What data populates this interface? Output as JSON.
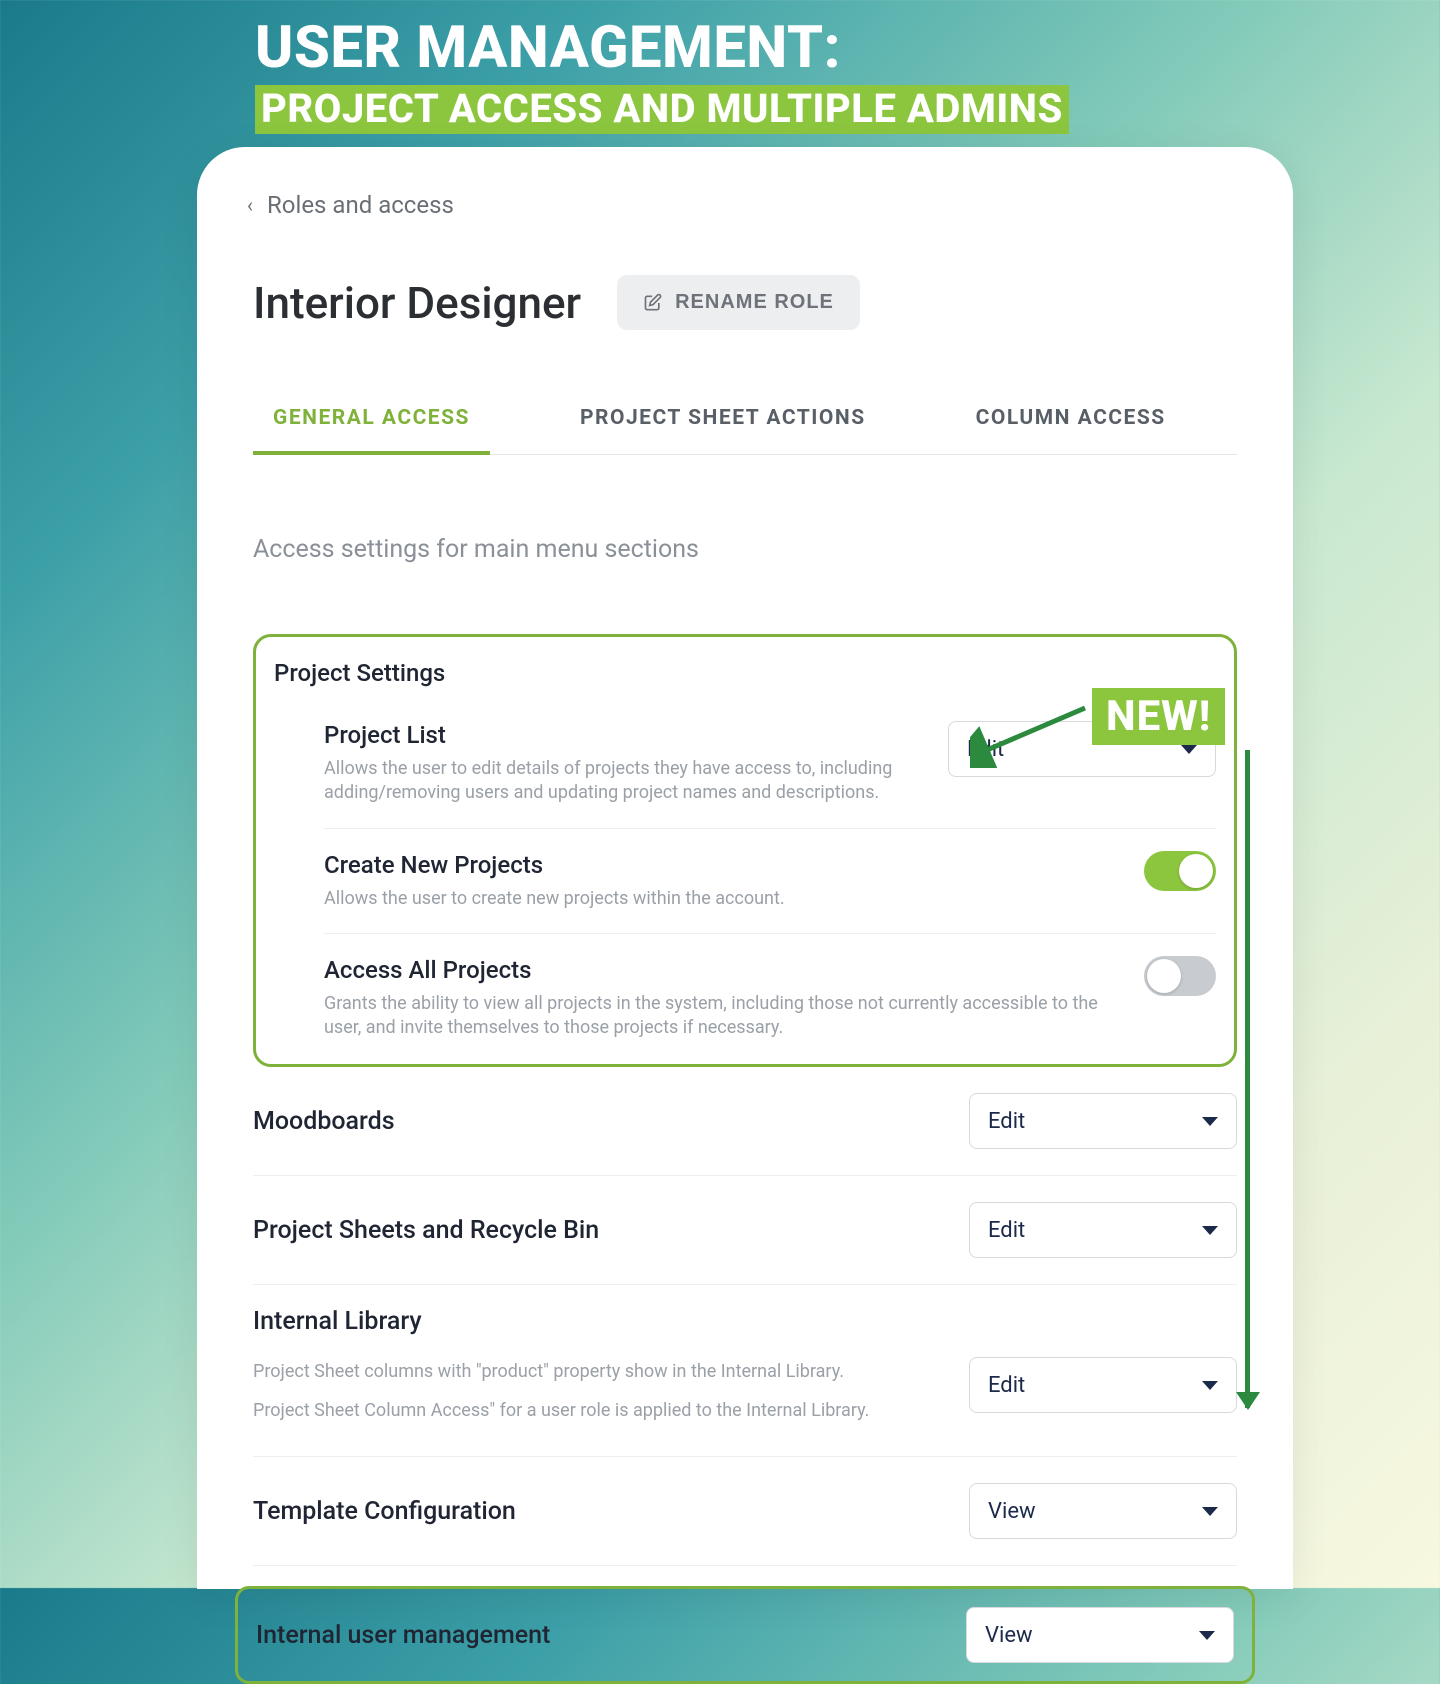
{
  "hero": {
    "title": "USER MANAGEMENT:",
    "subtitle": "PROJECT ACCESS AND MULTIPLE ADMINS"
  },
  "breadcrumb": {
    "label": "Roles and access"
  },
  "role": {
    "name": "Interior Designer",
    "rename_label": "RENAME ROLE"
  },
  "tabs": {
    "general": "GENERAL ACCESS",
    "project_sheet": "PROJECT SHEET ACTIONS",
    "column": "COLUMN ACCESS"
  },
  "section_description": "Access settings for main menu sections",
  "new_badge": "NEW!",
  "project_settings": {
    "title": "Project Settings",
    "project_list": {
      "title": "Project List",
      "desc": "Allows the user to edit details of projects they have access to, including adding/removing users and updating project names and descriptions.",
      "value": "Edit"
    },
    "create_new": {
      "title": "Create New Projects",
      "desc": "Allows the user to create new projects within the account.",
      "on": true
    },
    "access_all": {
      "title": "Access All Projects",
      "desc": "Grants the ability to view all projects in the system, including those not currently accessible to the user, and invite themselves to those projects if necessary.",
      "on": false
    }
  },
  "moodboards": {
    "title": "Moodboards",
    "value": "Edit"
  },
  "sheets_bin": {
    "title": "Project Sheets and Recycle Bin",
    "value": "Edit"
  },
  "internal_library": {
    "title": "Internal Library",
    "desc1": "Project Sheet columns with \"product\" property show in the Internal Library.",
    "desc2": "Project Sheet Column Access\" for a user role is applied to the Internal Library.",
    "value": "Edit"
  },
  "template_config": {
    "title": "Template Configuration",
    "value": "View"
  },
  "internal_user_mgmt": {
    "title": "Internal user management",
    "value": "View"
  }
}
